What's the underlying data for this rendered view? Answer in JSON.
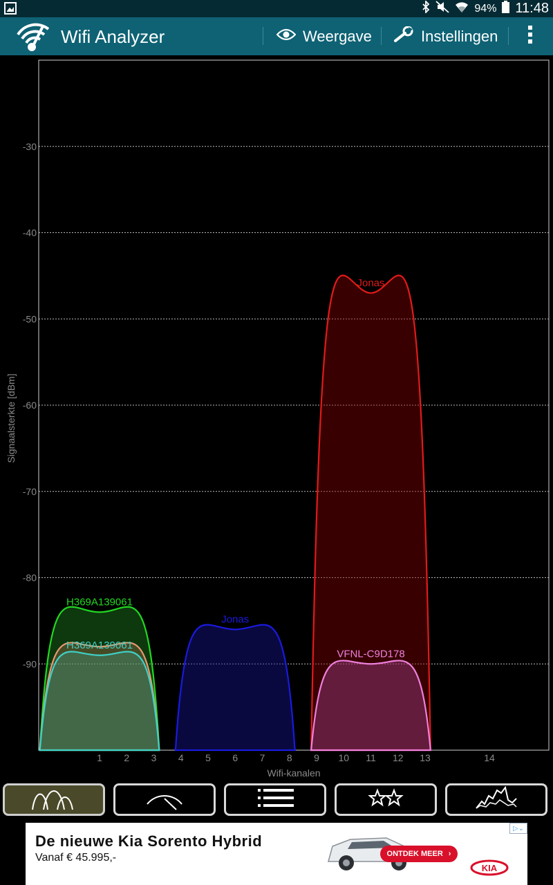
{
  "status_bar": {
    "battery_percent": "94%",
    "time": "11:48",
    "icons": [
      "screenshot-icon",
      "bluetooth-icon",
      "mute-icon",
      "wifi-icon",
      "battery-icon"
    ]
  },
  "action_bar": {
    "title": "Wifi Analyzer",
    "view_label": "Weergave",
    "settings_label": "Instellingen",
    "colors": {
      "background": "#0e6274",
      "status": "#062a33"
    }
  },
  "chart_data": {
    "type": "area",
    "xlabel": "Wifi-kanalen",
    "ylabel": "Signaalsterkte [dBm]",
    "x_ticks": [
      "1",
      "2",
      "3",
      "4",
      "5",
      "6",
      "7",
      "8",
      "9",
      "10",
      "11",
      "12",
      "13",
      "14"
    ],
    "y_ticks": [
      "-30",
      "-40",
      "-50",
      "-60",
      "-70",
      "-80",
      "-90"
    ],
    "ylim": [
      -100,
      -20
    ],
    "grid": true,
    "series": [
      {
        "name": "H369A139061",
        "channel": 1,
        "dbm": -84,
        "color": "#22d822",
        "fill": "rgba(40,160,40,0.35)"
      },
      {
        "name": "",
        "channel": 1,
        "dbm": -88,
        "color": "#e69a70",
        "fill": "rgba(200,120,90,0.30)"
      },
      {
        "name": "H369A139061",
        "channel": 1,
        "dbm": -89,
        "color": "#40d0c8",
        "fill": "rgba(60,160,140,0.35)"
      },
      {
        "name": "Jonas",
        "channel": 6,
        "dbm": -86,
        "color": "#1a1ae0",
        "fill": "rgba(20,20,140,0.45)"
      },
      {
        "name": "Jonas",
        "channel": 11,
        "dbm": -47,
        "color": "#e21a1a",
        "fill": "rgba(140,0,0,0.40)"
      },
      {
        "name": "VFNL-C9D178",
        "channel": 11,
        "dbm": -90,
        "color": "#f080e0",
        "fill": "rgba(180,80,170,0.35)"
      }
    ]
  },
  "tabs": [
    {
      "name": "channel-graph-tab",
      "icon": "channel-graph-icon",
      "active": true
    },
    {
      "name": "signal-meter-tab",
      "icon": "meter-icon",
      "active": false
    },
    {
      "name": "ap-list-tab",
      "icon": "list-icon",
      "active": false
    },
    {
      "name": "channel-rating-tab",
      "icon": "stars-icon",
      "active": false
    },
    {
      "name": "time-graph-tab",
      "icon": "time-graph-icon",
      "active": false
    }
  ],
  "ad": {
    "headline": "De nieuwe Kia Sorento Hybrid",
    "subline": "Vanaf € 45.995,-",
    "cta": "ONTDEK MEER",
    "brand": "KIA",
    "cta_color": "#d9102a"
  }
}
